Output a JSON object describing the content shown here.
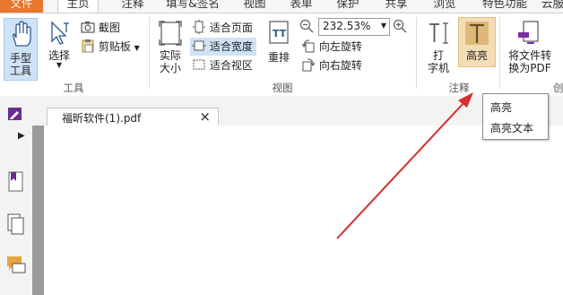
{
  "menu_tabs": [
    "文件",
    "主页",
    "注释",
    "填写&签名",
    "视图",
    "表单",
    "保护",
    "共享",
    "浏览",
    "特色功能",
    "云服"
  ],
  "tools_group": {
    "hand_tool": "手型\n工具",
    "select": "选择",
    "screenshot": "截图",
    "clipboard": "剪贴板",
    "label": "工具"
  },
  "view_group": {
    "actual_size": "实际\n大小",
    "fit_page": "适合页面",
    "fit_width": "适合宽度",
    "fit_view": "适合视区",
    "reflow": "重排",
    "zoom_value": "232.53%",
    "rotate_left": "向左旋转",
    "rotate_right": "向右旋转",
    "label": "视图"
  },
  "annotate_group": {
    "typewriter": "打\n字机",
    "highlight": "高亮",
    "label": "注释"
  },
  "convert_group": {
    "convert_pdf": "将文件转\n换为PDF",
    "partial_label": "创"
  },
  "document_tab": {
    "title": "福昕软件(1).pdf",
    "close": "×"
  },
  "tooltip": {
    "title": "高亮",
    "desc": "高亮文本"
  },
  "colors": {
    "file_tab": "#e8762b",
    "selected_button": "#cfe2f6",
    "highlight_button": "#f3ddb6",
    "arrow": "#d32f2f",
    "brand": "#6a2c8f"
  }
}
